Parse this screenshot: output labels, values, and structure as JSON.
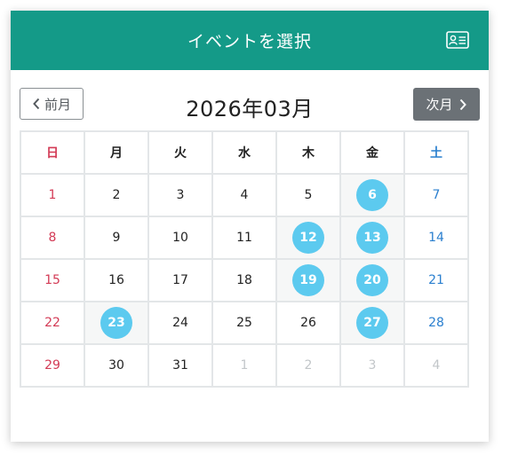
{
  "header": {
    "title": "イベントを選択",
    "icon": "id-card-icon"
  },
  "nav": {
    "prev_label": "前月",
    "next_label": "次月",
    "month_title": "2026年03月"
  },
  "weekdays": [
    "日",
    "月",
    "火",
    "水",
    "木",
    "金",
    "土"
  ],
  "weeks": [
    [
      {
        "d": "1"
      },
      {
        "d": "2"
      },
      {
        "d": "3"
      },
      {
        "d": "4"
      },
      {
        "d": "5"
      },
      {
        "d": "6",
        "event": true
      },
      {
        "d": "7"
      }
    ],
    [
      {
        "d": "8"
      },
      {
        "d": "9"
      },
      {
        "d": "10"
      },
      {
        "d": "11"
      },
      {
        "d": "12",
        "event": true
      },
      {
        "d": "13",
        "event": true
      },
      {
        "d": "14"
      }
    ],
    [
      {
        "d": "15"
      },
      {
        "d": "16"
      },
      {
        "d": "17"
      },
      {
        "d": "18"
      },
      {
        "d": "19",
        "event": true
      },
      {
        "d": "20",
        "event": true
      },
      {
        "d": "21"
      }
    ],
    [
      {
        "d": "22"
      },
      {
        "d": "23",
        "event": true
      },
      {
        "d": "24"
      },
      {
        "d": "25"
      },
      {
        "d": "26"
      },
      {
        "d": "27",
        "event": true
      },
      {
        "d": "28"
      }
    ],
    [
      {
        "d": "29"
      },
      {
        "d": "30"
      },
      {
        "d": "31"
      },
      {
        "d": "1",
        "other": true
      },
      {
        "d": "2",
        "other": true
      },
      {
        "d": "3",
        "other": true
      },
      {
        "d": "4",
        "other": true
      }
    ]
  ],
  "colors": {
    "header_bg": "#149a88",
    "event_bg": "#5ccaef",
    "sunday": "#d33a55",
    "saturday": "#2a7fcf",
    "next_button_bg": "#6b7176"
  }
}
